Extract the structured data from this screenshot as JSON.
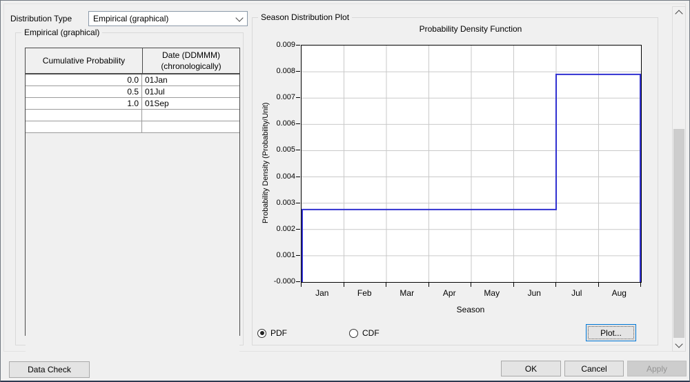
{
  "controls": {
    "distribution_type_label": "Distribution Type",
    "distribution_type_value": "Empirical (graphical)",
    "left_group_title": "Empirical (graphical)",
    "right_group_title": "Season Distribution Plot",
    "pdf_label": "PDF",
    "cdf_label": "CDF",
    "pdf_selected": true,
    "plot_button_label": "Plot...",
    "data_check_label": "Data Check",
    "ok_label": "OK",
    "cancel_label": "Cancel",
    "apply_label": "Apply",
    "apply_enabled": false
  },
  "table": {
    "col1_header": "Cumulative Probability",
    "col2_header_line1": "Date (DDMMM)",
    "col2_header_line2": "(chronologically)",
    "rows": [
      {
        "prob": "0.0",
        "date": "01Jan"
      },
      {
        "prob": "0.5",
        "date": "01Jul"
      },
      {
        "prob": "1.0",
        "date": "01Sep"
      },
      {
        "prob": "",
        "date": ""
      },
      {
        "prob": "",
        "date": ""
      }
    ]
  },
  "chart_data": {
    "type": "line",
    "subtype": "step-function-pdf",
    "title": "Probability Density Function",
    "xlabel": "Season",
    "ylabel": "Probability Density (Probability/Unit)",
    "x_categories": [
      "Jan",
      "Feb",
      "Mar",
      "Apr",
      "May",
      "Jun",
      "Jul",
      "Aug"
    ],
    "x_span_months": 8,
    "ylim": [
      0,
      0.009
    ],
    "y_tick_step": 0.001,
    "grid": true,
    "gridline_color": "#c9c9c9",
    "line_color": "#3030d0",
    "steps": [
      {
        "from": "01Jan",
        "to": "01Jul",
        "density": 0.00276
      },
      {
        "from": "01Jul",
        "to": "01Sep",
        "density": 0.0079
      }
    ]
  }
}
